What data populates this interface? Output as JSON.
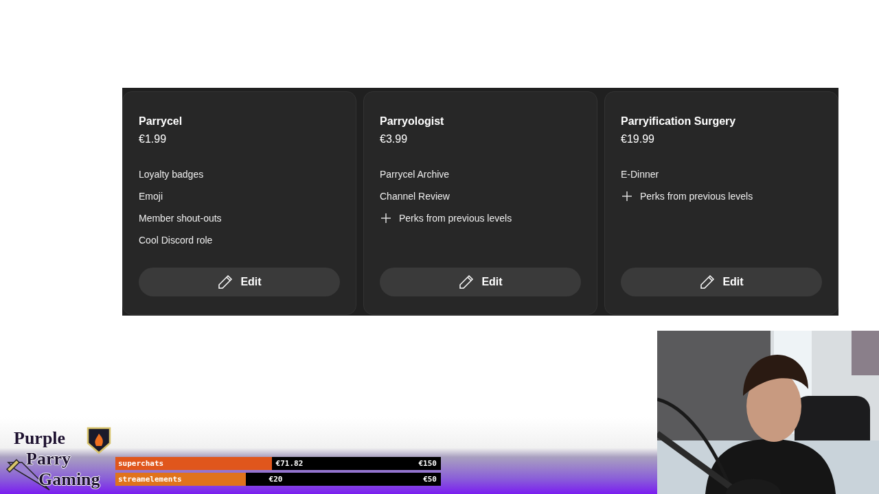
{
  "tiers": [
    {
      "name": "Parrycel",
      "price": "€1.99",
      "perks": [
        {
          "text": "Loyalty badges",
          "kind": "plain"
        },
        {
          "text": "Emoji",
          "kind": "plain"
        },
        {
          "text": "Member shout-outs",
          "kind": "plain"
        },
        {
          "text": "Cool Discord role",
          "kind": "plain"
        }
      ],
      "button": "Edit"
    },
    {
      "name": "Parryologist",
      "price": "€3.99",
      "perks": [
        {
          "text": "Parrycel Archive",
          "kind": "plain"
        },
        {
          "text": "Channel Review",
          "kind": "plain"
        },
        {
          "text": "Perks from previous levels",
          "kind": "plus"
        }
      ],
      "button": "Edit"
    },
    {
      "name": "Parryification Surgery",
      "price": "€19.99",
      "perks": [
        {
          "text": "E-Dinner",
          "kind": "plain"
        },
        {
          "text": "Perks from previous levels",
          "kind": "plus"
        }
      ],
      "button": "Edit"
    }
  ],
  "overlay": {
    "logo_lines": [
      "Purple",
      "Parry",
      "Gaming"
    ],
    "goals": [
      {
        "label": "superchats",
        "current": "€71.82",
        "target": "€150",
        "level": 0.48,
        "color": "#e0561c"
      },
      {
        "label": "streamelements",
        "current": "€20",
        "target": "€50",
        "level": 0.4,
        "color": "#e0731c"
      }
    ]
  }
}
